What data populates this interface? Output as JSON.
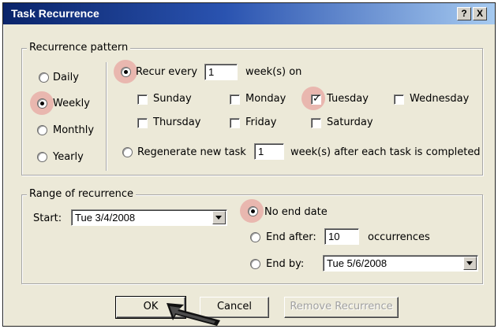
{
  "window": {
    "title": "Task Recurrence",
    "help_button": "?",
    "close_button": "X"
  },
  "recurrence_pattern": {
    "legend": "Recurrence pattern",
    "frequency_options": [
      {
        "label": "Daily",
        "selected": false
      },
      {
        "label": "Weekly",
        "selected": true
      },
      {
        "label": "Monthly",
        "selected": false
      },
      {
        "label": "Yearly",
        "selected": false
      }
    ],
    "recur_every": {
      "label": "Recur every",
      "value": "1",
      "suffix": "week(s) on",
      "selected": true
    },
    "days": [
      {
        "label": "Sunday",
        "checked": false
      },
      {
        "label": "Monday",
        "checked": false
      },
      {
        "label": "Tuesday",
        "checked": true
      },
      {
        "label": "Wednesday",
        "checked": false
      },
      {
        "label": "Thursday",
        "checked": false
      },
      {
        "label": "Friday",
        "checked": false
      },
      {
        "label": "Saturday",
        "checked": false
      }
    ],
    "regenerate": {
      "label": "Regenerate new task",
      "value": "1",
      "suffix": "week(s) after each task is completed",
      "selected": false
    }
  },
  "range_of_recurrence": {
    "legend": "Range of recurrence",
    "start_label": "Start:",
    "start_value": "Tue 3/4/2008",
    "no_end_date": {
      "label": "No end date",
      "selected": true
    },
    "end_after": {
      "label": "End after:",
      "value": "10",
      "suffix": "occurrences",
      "selected": false
    },
    "end_by": {
      "label": "End by:",
      "value": "Tue 5/6/2008",
      "selected": false
    }
  },
  "buttons": {
    "ok": "OK",
    "cancel": "Cancel",
    "remove": "Remove Recurrence"
  },
  "colors": {
    "titlebar_start": "#0a246a",
    "titlebar_end": "#a6caf0",
    "dialog_bg": "#ece9d8",
    "highlight": "#e88e8e"
  }
}
